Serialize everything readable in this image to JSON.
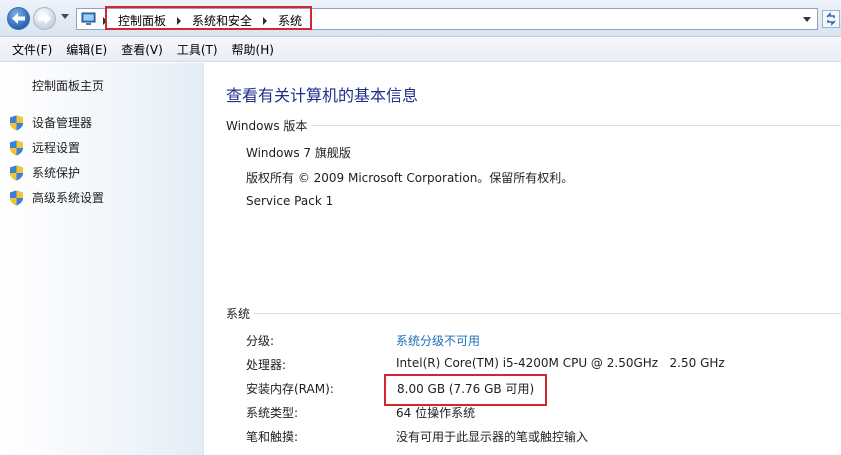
{
  "address_bar": {
    "breadcrumbs": [
      "控制面板",
      "系统和安全",
      "系统"
    ]
  },
  "menu": [
    "文件(F)",
    "编辑(E)",
    "查看(V)",
    "工具(T)",
    "帮助(H)"
  ],
  "sidebar": {
    "home": "控制面板主页",
    "items": [
      {
        "label": "设备管理器",
        "icon": "shield-icon"
      },
      {
        "label": "远程设置",
        "icon": "shield-icon"
      },
      {
        "label": "系统保护",
        "icon": "shield-icon"
      },
      {
        "label": "高级系统设置",
        "icon": "shield-icon"
      }
    ]
  },
  "main": {
    "title": "查看有关计算机的基本信息",
    "windows_edition": {
      "heading": "Windows 版本",
      "lines": [
        "Windows 7 旗舰版",
        "版权所有 © 2009 Microsoft Corporation。保留所有权利。",
        "Service Pack 1"
      ]
    },
    "system": {
      "heading": "系统",
      "rows": [
        {
          "label": "分级:",
          "value": "系统分级不可用"
        },
        {
          "label": "处理器:",
          "value": "Intel(R) Core(TM) i5-4200M CPU @ 2.50GHz   2.50 GHz"
        },
        {
          "label": "安装内存(RAM):",
          "value": "8.00 GB (7.76 GB 可用)"
        },
        {
          "label": "系统类型:",
          "value": "64 位操作系统"
        },
        {
          "label": "笔和触摸:",
          "value": "没有可用于此显示器的笔或触控输入"
        }
      ]
    }
  },
  "colors": {
    "highlight": "#d3262f",
    "link": "#1f6fb5",
    "title": "#1e3287"
  }
}
